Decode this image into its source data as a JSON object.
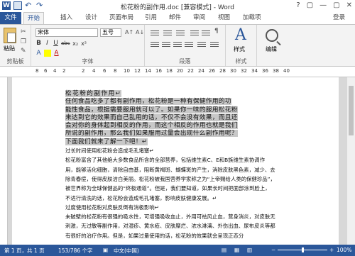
{
  "window": {
    "title": "松花粉的副作用.doc [兼容模式] - Word",
    "controls": [
      "?",
      "▢",
      "—",
      "▢",
      "✕"
    ]
  },
  "qat": {
    "icons": [
      "word-logo-icon",
      "save-icon",
      "undo-icon",
      "redo-icon"
    ],
    "word_letter": "W"
  },
  "tabs": [
    {
      "label": "文件"
    },
    {
      "label": "开始"
    },
    {
      "label": "插入"
    },
    {
      "label": "设计"
    },
    {
      "label": "页面布局"
    },
    {
      "label": "引用"
    },
    {
      "label": "邮件"
    },
    {
      "label": "审阅"
    },
    {
      "label": "视图"
    },
    {
      "label": "加载项"
    }
  ],
  "login": "登录",
  "ribbon": {
    "paste_label": "粘贴",
    "clipboard_group": "剪贴板",
    "font_name": "宋体",
    "font_size": "五号",
    "font_group": "字体",
    "paragraph_group": "段落",
    "styles_label": "样式",
    "styles_group": "样式",
    "edit_label": "编辑",
    "format_buttons": [
      "B",
      "I",
      "U",
      "abc",
      "x₂",
      "x²",
      "A"
    ]
  },
  "ruler": {
    "ticks": [
      "8",
      "6",
      "4",
      "2",
      "",
      "2",
      "4",
      "6",
      "8",
      "10",
      "12",
      "14",
      "16",
      "18",
      "20",
      "22",
      "24",
      "26",
      "28",
      "30",
      "32",
      "34",
      "36",
      "38",
      "40"
    ]
  },
  "document": {
    "selected_lines": [
      "松花粉的副作用↵",
      "任何食品吃多了都有副作用，松花粉是一种有保健作用的功",
      "能性食品，根据需要服用就可以了。如果你一味的服用松花粉",
      "来达到它的效果而自己乱用的话，不仅不会没有效果，而且还",
      "会对你的身体起到相反的作用，而这个相反的作用也就是我们",
      "所说的副作用，那么我们如果服用过量会出现什么副作用呢？",
      "下面我们就来了解一下吧！↵"
    ],
    "body_lines": [
      "过长时间使用松花粉会造成毛孔堵塞↵",
      "松花粉富含了其他绝大多数食品所含的全部营养，包括维生素C、E和B族维生素协调作",
      "用，能够活化细胞，清除自由基，阻断黄褐斑、蝴蝶斑的产生，消除皮肤黑色素，减少、去",
      "除青春痘，使得皮肤洁白美丽。松花粉被我国营养学家称之为“上帝赐给人类的保健珍品”，",
      "被世界称为全球保健品的“终极通道”。但是，我们要知道，如果长时间把面部涂到脸上，",
      "不进行清洗的话，松花粉会造成毛孔堵塞，影响皮肤健康发展。↵",
      "过度使用松花粉对皮肤反倒有消极影响↵",
      "未破壁的松花粉有很强的吸水性，可增强吸收血止，外用可祛风止血，营身消炎，对皮肤无",
      "刺激，无过敏等副作用，对湿疹、黄水疮、皮肤糜烂、浓水淋漓、外伤出血、尿布皮炎等都",
      "有很好的治疗作用。但是，如果过量使用的话，松花粉的效果就会呈现正态分"
    ]
  },
  "status": {
    "page": "第 1 页，共 1 页",
    "words": "153/786 个字",
    "lang": "中文(中国)",
    "zoom_minus": "−",
    "zoom_plus": "+",
    "zoom_level": "100%"
  }
}
